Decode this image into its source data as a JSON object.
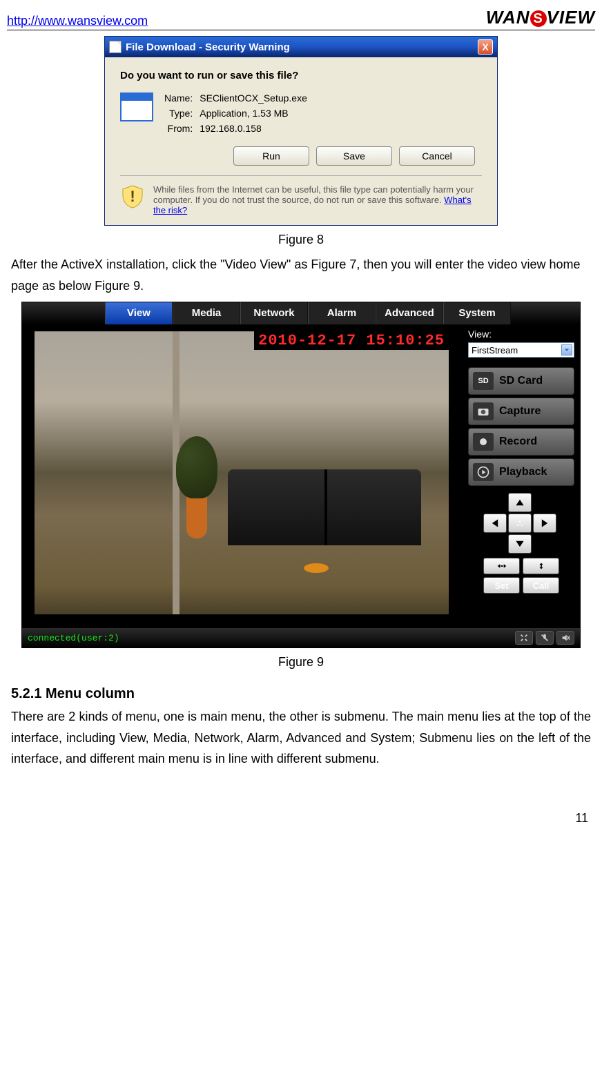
{
  "header": {
    "url": "http://www.wansview.com",
    "logo_text_before": "WAN",
    "logo_s": "S",
    "logo_text_after": "VIEW"
  },
  "dialog": {
    "title": "File Download - Security Warning",
    "close": "X",
    "question": "Do you want to run or save this file?",
    "name_label": "Name:",
    "name_value": "SEClientOCX_Setup.exe",
    "type_label": "Type:",
    "type_value": "Application, 1.53 MB",
    "from_label": "From:",
    "from_value": "192.168.0.158",
    "run_btn": "Run",
    "save_btn": "Save",
    "cancel_btn": "Cancel",
    "warning_text": "While files from the Internet can be useful, this file type can potentially harm your computer. If you do not trust the source, do not run or save this software. ",
    "risk_link": "What's the risk?"
  },
  "captions": {
    "fig8": "Figure 8",
    "fig9": "Figure 9"
  },
  "paragraph1": "After the ActiveX installation, click the \"Video View\" as Figure 7, then you will enter the video view home page as below Figure 9.",
  "viewer": {
    "tabs": [
      "View",
      "Media",
      "Network",
      "Alarm",
      "Advanced",
      "System"
    ],
    "timestamp": "2010-12-17 15:10:25",
    "view_label": "View:",
    "stream_selected": "FirstStream",
    "buttons": {
      "sdcard": "SD Card",
      "capture": "Capture",
      "record": "Record",
      "playback": "Playback"
    },
    "setcall": {
      "set": "Set",
      "call": "Call"
    },
    "status": "connected(user:2)"
  },
  "section": {
    "heading": "5.2.1  Menu column",
    "text": "There are 2 kinds of menu, one is main menu, the other is submenu. The main menu lies at the top of the interface, including View, Media, Network, Alarm, Advanced and System; Submenu lies on the left of the interface, and different main menu is in line with different submenu."
  },
  "page_number": "11"
}
